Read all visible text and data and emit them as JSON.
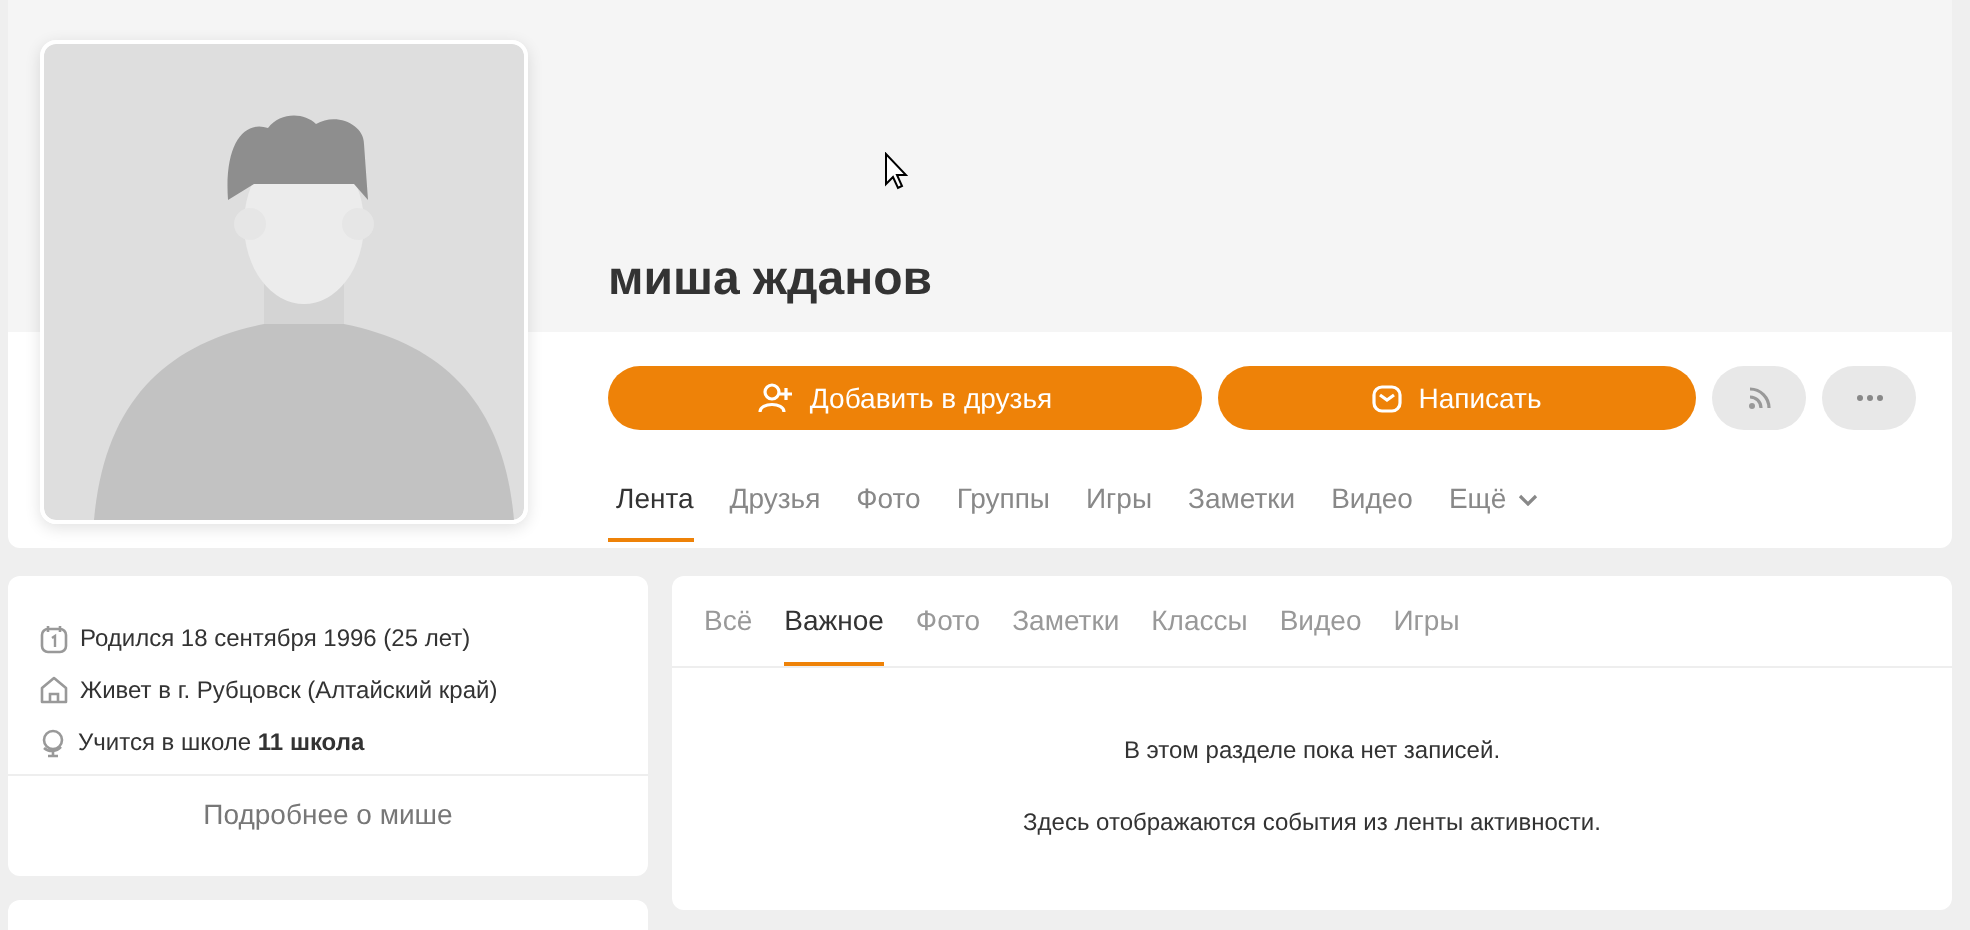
{
  "profile": {
    "name": "миша жданов"
  },
  "actions": [
    {
      "kind": "add-friend",
      "label": "Добавить в друзья"
    },
    {
      "kind": "message",
      "label": "Написать"
    },
    {
      "kind": "subscribe"
    },
    {
      "kind": "more"
    }
  ],
  "profile_tabs": [
    {
      "label": "Лента",
      "selected": true
    },
    {
      "label": "Друзья",
      "selected": false
    },
    {
      "label": "Фото",
      "selected": false
    },
    {
      "label": "Группы",
      "selected": false
    },
    {
      "label": "Игры",
      "selected": false
    },
    {
      "label": "Заметки",
      "selected": false
    },
    {
      "label": "Видео",
      "selected": false
    },
    {
      "label": "Ещё",
      "selected": false,
      "dropdown": true
    }
  ],
  "about": {
    "items": [
      {
        "kind": "birthday",
        "text": "Родился 18 сентября 1996 (25 лет)"
      },
      {
        "kind": "home",
        "text": "Живет в г. Рубцовск (Алтайский край)"
      },
      {
        "kind": "school",
        "text": "Учится в школе **11 школа**"
      }
    ],
    "more_link": "Подробнее о мише"
  },
  "feed": {
    "tabs": [
      {
        "label": "Всё",
        "selected": false
      },
      {
        "label": "Важное",
        "selected": true
      },
      {
        "label": "Фото",
        "selected": false
      },
      {
        "label": "Заметки",
        "selected": false
      },
      {
        "label": "Классы",
        "selected": false
      },
      {
        "label": "Видео",
        "selected": false
      },
      {
        "label": "Игры",
        "selected": false
      }
    ],
    "empty_messages": [
      "В этом разделе пока нет записей.",
      "Здесь отображаются события из ленты активности."
    ]
  }
}
